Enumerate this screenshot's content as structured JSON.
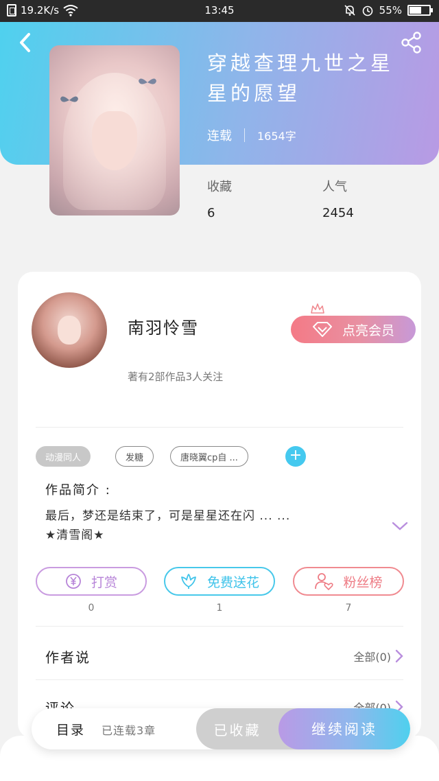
{
  "status_bar": {
    "net_speed": "19.2K/s",
    "time": "13:45",
    "battery": "55%",
    "icons": [
      "notification-box-icon",
      "wifi-icon",
      "mute-bell-icon",
      "alarm-icon",
      "battery-icon"
    ]
  },
  "book": {
    "title": "穿越查理九世之星星的愿望",
    "status": "连载",
    "words": "1654字",
    "favorites_label": "收藏",
    "favorites_value": "6",
    "popularity_label": "人气",
    "popularity_value": "2454"
  },
  "author": {
    "name": "南羽怜雪",
    "summary": "著有2部作品3人关注",
    "vip_label": "点亮会员"
  },
  "tags": [
    "动漫同人",
    "发糖",
    "唐晓翼cp自 ..."
  ],
  "intro": {
    "title": "作品简介 :",
    "line1": "最后，梦还是结束了，可是星星还在闪 ... ...",
    "line2": "★清雪阁★"
  },
  "actions": [
    {
      "label": "打赏",
      "count": "0",
      "icon": "yen-coin-icon"
    },
    {
      "label": "免费送花",
      "count": "1",
      "icon": "flower-icon"
    },
    {
      "label": "粉丝榜",
      "count": "7",
      "icon": "user-heart-icon"
    }
  ],
  "author_says": {
    "title": "作者说",
    "right": "全部(0)"
  },
  "comments": {
    "title": "评论",
    "right": "全部(0)"
  },
  "bottom_bar": {
    "toc_label": "目录",
    "chapters": "已连载3章",
    "collected_label": "已收藏",
    "read_label": "继续阅读"
  },
  "colors": {
    "header_gradient_start": "#4fd1ee",
    "header_gradient_end": "#b89ae4",
    "accent_blue": "#45c9ef",
    "accent_purple": "#b784d8",
    "accent_red": "#ee7b84"
  }
}
